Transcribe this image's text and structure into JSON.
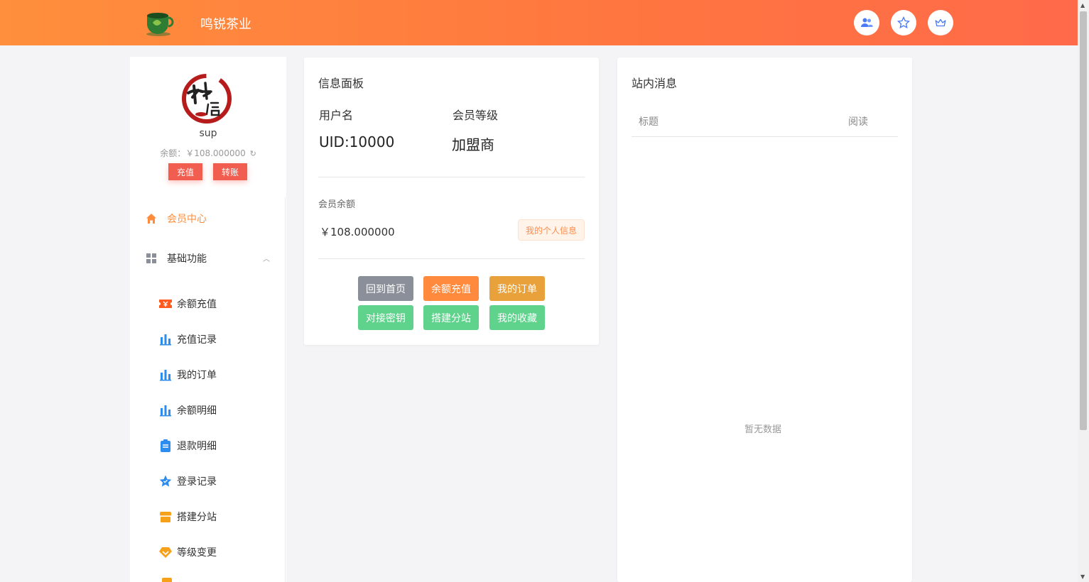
{
  "header": {
    "site_title": "鸣锐茶业",
    "icons": [
      "users-icon",
      "star-icon",
      "crown-icon"
    ]
  },
  "profile": {
    "username": "sup",
    "balance_text": "余额：￥108.000000",
    "recharge_button": "充值",
    "transfer_button": "转账"
  },
  "sidebar": {
    "member_center": "会员中心",
    "basic_functions": "基础功能",
    "items": [
      {
        "label": "余额充值",
        "icon": "ticket-icon"
      },
      {
        "label": "充值记录",
        "icon": "bar-chart-icon"
      },
      {
        "label": "我的订单",
        "icon": "bar-chart-icon"
      },
      {
        "label": "余额明细",
        "icon": "bar-chart-icon"
      },
      {
        "label": "退款明细",
        "icon": "clipboard-icon"
      },
      {
        "label": "登录记录",
        "icon": "star-icon"
      },
      {
        "label": "搭建分站",
        "icon": "store-icon"
      },
      {
        "label": "等级变更",
        "icon": "heart-badge-icon"
      }
    ]
  },
  "info_panel": {
    "title": "信息面板",
    "username_label": "用户名",
    "username_value": "UID:10000",
    "level_label": "会员等级",
    "level_value": "加盟商",
    "balance_label": "会员余额",
    "balance_value": "￥108.000000",
    "my_info_button": "我的个人信息",
    "actions": [
      {
        "label": "回到首页",
        "color": "#8a8f99"
      },
      {
        "label": "余额充值",
        "color": "#ff8a3d"
      },
      {
        "label": "我的订单",
        "color": "#e9a23b"
      },
      {
        "label": "对接密钥",
        "color": "#5fd28c"
      },
      {
        "label": "搭建分站",
        "color": "#5fd28c"
      },
      {
        "label": "我的收藏",
        "color": "#5fd28c"
      }
    ]
  },
  "messages": {
    "title": "站内消息",
    "col_title": "标题",
    "col_read": "阅读",
    "empty_text": "暂无数据"
  },
  "colors": {
    "accent": "#ff7f3f",
    "danger": "#f15d4f",
    "green": "#5fd28c"
  }
}
